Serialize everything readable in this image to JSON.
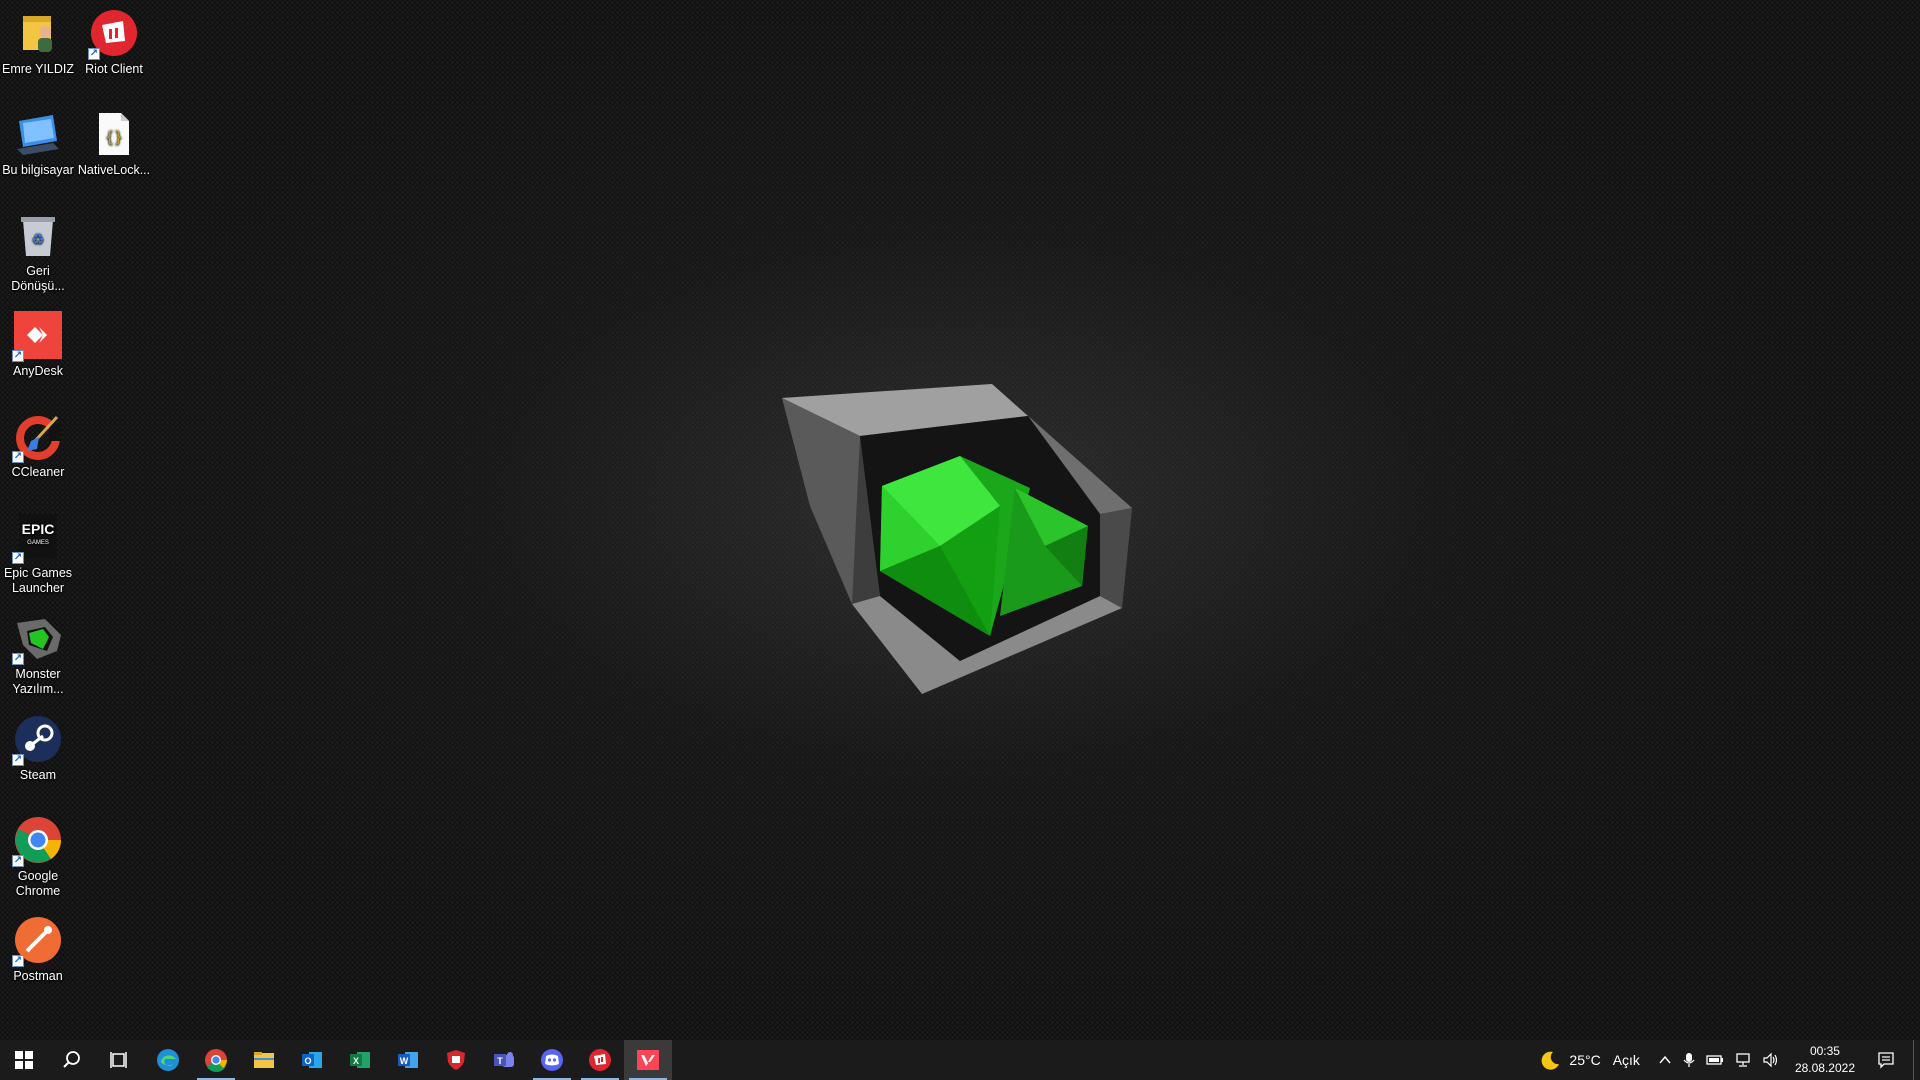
{
  "desktop": {
    "icons": [
      {
        "label": "Emre YILDIZ",
        "icon": "user-folder-icon"
      },
      {
        "label": "Riot Client",
        "icon": "riot-client-icon"
      },
      {
        "label": "Bu bilgisayar",
        "icon": "this-pc-icon"
      },
      {
        "label": "NativeLock...",
        "icon": "json-file-icon"
      },
      {
        "label": "Geri Dönüşü...",
        "icon": "recycle-bin-icon"
      },
      {
        "label": "AnyDesk",
        "icon": "anydesk-icon"
      },
      {
        "label": "CCleaner",
        "icon": "ccleaner-icon"
      },
      {
        "label": "Epic Games Launcher",
        "icon": "epic-games-icon",
        "logo_text": "EPIC",
        "logo_subtext": "GAMES"
      },
      {
        "label": "Monster Yazılım...",
        "icon": "monster-software-icon"
      },
      {
        "label": "Steam",
        "icon": "steam-icon"
      },
      {
        "label": "Google Chrome",
        "icon": "chrome-icon"
      },
      {
        "label": "Postman",
        "icon": "postman-icon"
      }
    ],
    "wallpaper": "monster-notebook-logo",
    "colors": {
      "wallpaper_base": "#0f0f0f",
      "logo_green": "#22c522"
    }
  },
  "taskbar": {
    "buttons": [
      {
        "name": "start",
        "icon": "windows-start-icon"
      },
      {
        "name": "search",
        "icon": "search-icon"
      },
      {
        "name": "task-view",
        "icon": "task-view-icon"
      },
      {
        "name": "edge",
        "icon": "edge-icon"
      },
      {
        "name": "chrome",
        "icon": "chrome-icon",
        "running": true
      },
      {
        "name": "file-explorer",
        "icon": "folder-icon"
      },
      {
        "name": "outlook",
        "icon": "outlook-icon"
      },
      {
        "name": "excel",
        "icon": "excel-icon"
      },
      {
        "name": "word",
        "icon": "word-icon"
      },
      {
        "name": "security",
        "icon": "shield-app-icon"
      },
      {
        "name": "teams",
        "icon": "teams-icon"
      },
      {
        "name": "discord",
        "icon": "discord-icon",
        "running": true
      },
      {
        "name": "riot-client",
        "icon": "riot-client-icon",
        "running": true
      },
      {
        "name": "valorant",
        "icon": "valorant-icon",
        "running": true,
        "active": true
      }
    ],
    "tray": {
      "weather_temp": "25°C",
      "weather_desc": "Açık",
      "weather_icon": "moon-icon",
      "time": "00:35",
      "date": "28.08.2022"
    }
  }
}
